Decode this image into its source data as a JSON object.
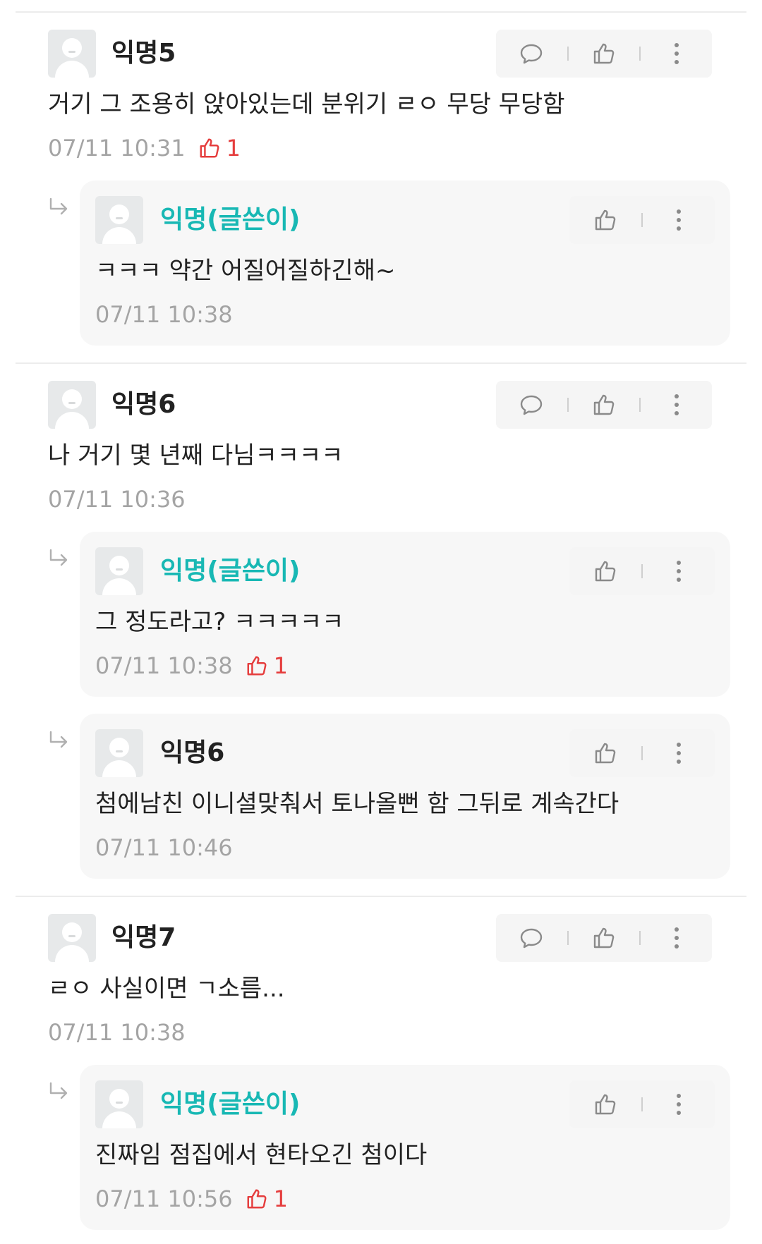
{
  "colors": {
    "author": "#18b8b4",
    "like_red": "#e53d3d",
    "meta_gray": "#a4a4a4"
  },
  "comments": [
    {
      "name": "익명5",
      "text": "거기 그 조용히 앉아있는데 분위기 ㄹㅇ 무당 무당함",
      "time": "07/11 10:31",
      "likes": "1",
      "replies": [
        {
          "name": "익명(글쓴이)",
          "text": "ㅋㅋㅋ 약간 어질어질하긴해~",
          "time": "07/11 10:38"
        }
      ]
    },
    {
      "name": "익명6",
      "text": "나 거기 몇 년째 다님ㅋㅋㅋㅋ",
      "time": "07/11 10:36",
      "replies": [
        {
          "name": "익명(글쓴이)",
          "text": "그 정도라고? ㅋㅋㅋㅋㅋ",
          "time": "07/11 10:38",
          "likes": "1"
        },
        {
          "name": "익명6",
          "text": "첨에남친 이니셜맞춰서 토나올뻔 함 그뒤로 계속간다",
          "time": "07/11 10:46"
        }
      ]
    },
    {
      "name": "익명7",
      "text": "ㄹㅇ 사실이면 ㄱ소름...",
      "time": "07/11 10:38",
      "replies": [
        {
          "name": "익명(글쓴이)",
          "text": "진짜임 점집에서 현타오긴 첨이다",
          "time": "07/11 10:56",
          "likes": "1"
        }
      ]
    }
  ]
}
